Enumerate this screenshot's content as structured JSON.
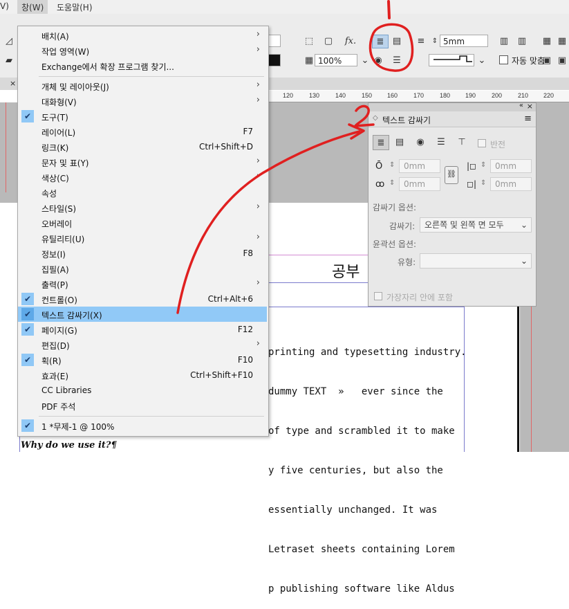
{
  "menubar": {
    "left_partial": "V)",
    "window": "창(W)",
    "help": "도움말(H)"
  },
  "toolbar": {
    "fx": "fx.",
    "stroke_value": "5mm",
    "zoom_value": "100%",
    "auto_fit_label": "자동 맞춤"
  },
  "ruler": {
    "ticks": [
      "120",
      "130",
      "140",
      "150",
      "160",
      "170",
      "180",
      "190",
      "200",
      "210",
      "220"
    ]
  },
  "menu": {
    "items": [
      {
        "label": "배치(A)",
        "shortcut": "",
        "submenu": true,
        "checked": false
      },
      {
        "label": "작업 영역(W)",
        "shortcut": "",
        "submenu": true,
        "checked": false
      },
      {
        "label": "Exchange에서 확장 프로그램 찾기...",
        "shortcut": "",
        "submenu": false,
        "checked": false
      },
      {
        "label": "개체 및 레이아웃(J)",
        "shortcut": "",
        "submenu": true,
        "checked": false
      },
      {
        "label": "대화형(V)",
        "shortcut": "",
        "submenu": true,
        "checked": false
      },
      {
        "label": "도구(T)",
        "shortcut": "",
        "submenu": false,
        "checked": true
      },
      {
        "label": "레이어(L)",
        "shortcut": "F7",
        "submenu": false,
        "checked": false
      },
      {
        "label": "링크(K)",
        "shortcut": "Ctrl+Shift+D",
        "submenu": false,
        "checked": false
      },
      {
        "label": "문자 및 표(Y)",
        "shortcut": "",
        "submenu": true,
        "checked": false
      },
      {
        "label": "색상(C)",
        "shortcut": "",
        "submenu": true,
        "checked": false
      },
      {
        "label": "속성",
        "shortcut": "",
        "submenu": false,
        "checked": false
      },
      {
        "label": "스타일(S)",
        "shortcut": "",
        "submenu": true,
        "checked": false
      },
      {
        "label": "오버레이",
        "shortcut": "",
        "submenu": false,
        "checked": false
      },
      {
        "label": "유틸리티(U)",
        "shortcut": "",
        "submenu": true,
        "checked": false
      },
      {
        "label": "정보(I)",
        "shortcut": "F8",
        "submenu": false,
        "checked": false
      },
      {
        "label": "집필(A)",
        "shortcut": "",
        "submenu": false,
        "checked": false
      },
      {
        "label": "출력(P)",
        "shortcut": "",
        "submenu": true,
        "checked": false
      },
      {
        "label": "컨트롤(O)",
        "shortcut": "Ctrl+Alt+6",
        "submenu": false,
        "checked": true
      },
      {
        "label": "텍스트 감싸기(X)",
        "shortcut": "",
        "submenu": false,
        "checked": true,
        "highlighted": true
      },
      {
        "label": "페이지(G)",
        "shortcut": "F12",
        "submenu": false,
        "checked": true
      },
      {
        "label": "편집(D)",
        "shortcut": "",
        "submenu": true,
        "checked": false
      },
      {
        "label": "획(R)",
        "shortcut": "F10",
        "submenu": false,
        "checked": true
      },
      {
        "label": "효과(E)",
        "shortcut": "Ctrl+Shift+F10",
        "submenu": false,
        "checked": false
      },
      {
        "label": "CC Libraries",
        "shortcut": "",
        "submenu": false,
        "checked": false
      },
      {
        "label": "PDF 주석",
        "shortcut": "",
        "submenu": false,
        "checked": false
      },
      {
        "label": "1 *무제-1 @ 100%",
        "shortcut": "",
        "submenu": false,
        "checked": true
      }
    ]
  },
  "panel": {
    "title": "텍스트 감싸기",
    "invert_label": "반전",
    "top_offset": "0mm",
    "bottom_offset": "0mm",
    "left_offset": "0mm",
    "right_offset": "0mm",
    "wrap_options_label": "감싸기 옵션:",
    "wrap_to_label": "감싸기:",
    "wrap_to_value": "오른쪽 및 왼쪽 면 모두",
    "contour_label": "윤곽선 옵션:",
    "type_label": "유형:",
    "type_value": "",
    "include_inside_label": "가장자리 안에 포함"
  },
  "document": {
    "heading_partial": "공부",
    "body_lines": [
      "printing and typesetting industry.",
      "dummy TEXT  »   ever since the",
      "of type and scrambled it to make",
      "y five centuries, but also the",
      "essentially unchanged. It was",
      "Letraset sheets containing Lorem",
      "p publishing software like Aldus"
    ],
    "italic_line": "Why do we use it?¶"
  },
  "annotations": {
    "step2": "2"
  }
}
